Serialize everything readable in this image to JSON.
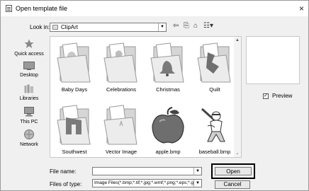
{
  "window": {
    "title": "Open template file",
    "close_glyph": "×"
  },
  "look_in": {
    "label": "Look in:",
    "value": "ClipArt"
  },
  "toolbar": {
    "back_glyph": "⇦",
    "up_glyph": "⎘",
    "new_folder_glyph": "⌂",
    "view_glyph": "☷▾"
  },
  "places": [
    {
      "label": "Quick access",
      "icon": "star-icon"
    },
    {
      "label": "Desktop",
      "icon": "desktop-icon"
    },
    {
      "label": "Libraries",
      "icon": "libraries-icon"
    },
    {
      "label": "This PC",
      "icon": "computer-icon"
    },
    {
      "label": "Network",
      "icon": "network-icon"
    }
  ],
  "files": [
    {
      "label": "Baby Days",
      "kind": "folder"
    },
    {
      "label": "Celebrations",
      "kind": "folder"
    },
    {
      "label": "Christmas",
      "kind": "folder"
    },
    {
      "label": "Quilt",
      "kind": "folder"
    },
    {
      "label": "Southwest",
      "kind": "folder"
    },
    {
      "label": "Vector Image",
      "kind": "folder"
    },
    {
      "label": "apple.bmp",
      "kind": "image"
    },
    {
      "label": "baseball.bmp",
      "kind": "image"
    }
  ],
  "scroll": {
    "up": "▲",
    "down": "⌄"
  },
  "preview": {
    "label": "Preview",
    "checked": true,
    "check_glyph": "✓"
  },
  "file_name": {
    "label": "File name:",
    "value": ""
  },
  "files_of_type": {
    "label": "Files of type:",
    "value": "Image Files(*.bmp;*.tif;*.jpg;*.wmf;*.png;*.eps;*.g"
  },
  "buttons": {
    "open": "Open",
    "cancel": "Cancel"
  },
  "combo_arrow": "▼"
}
